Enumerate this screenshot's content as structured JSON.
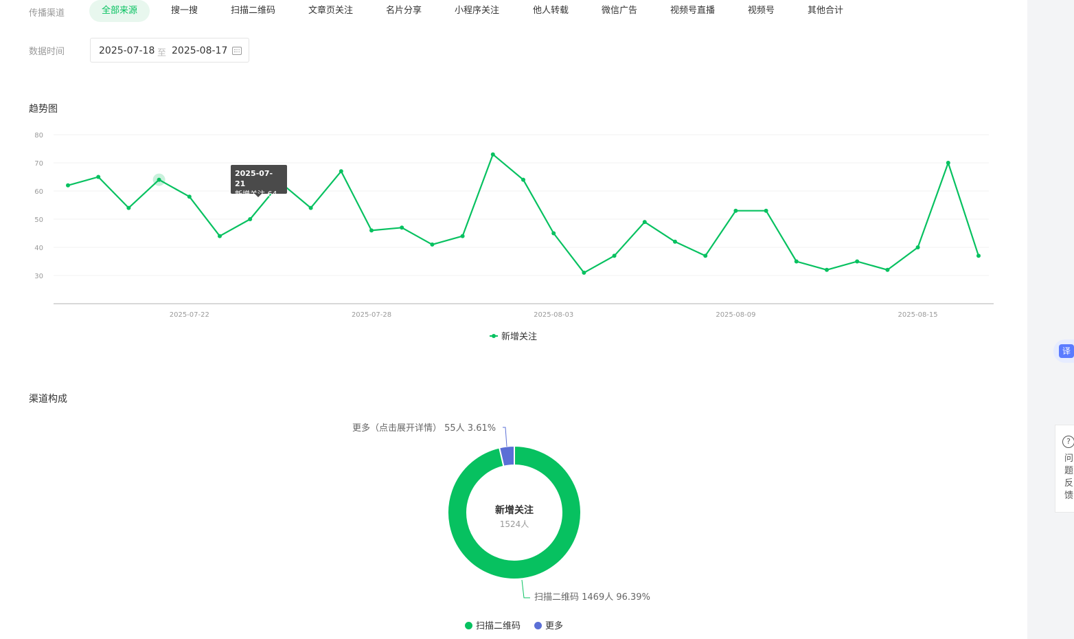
{
  "filters": {
    "source_label": "传播渠道",
    "source_tabs": [
      {
        "label": "全部来源",
        "active": true
      },
      {
        "label": "搜一搜"
      },
      {
        "label": "扫描二维码"
      },
      {
        "label": "文章页关注"
      },
      {
        "label": "名片分享"
      },
      {
        "label": "小程序关注"
      },
      {
        "label": "他人转载"
      },
      {
        "label": "微信广告"
      },
      {
        "label": "视频号直播"
      },
      {
        "label": "视频号"
      },
      {
        "label": "其他合计"
      }
    ],
    "date_label": "数据时间",
    "date_start": "2025-07-18",
    "date_separator": "至",
    "date_end": "2025-08-17"
  },
  "trend": {
    "title": "趋势图",
    "tooltip": {
      "date": "2025-07-21",
      "text": "新增关注 64"
    }
  },
  "channel": {
    "title": "渠道构成",
    "center_title": "新增关注",
    "center_value": "1524人",
    "label_more": "更多（点击展开详情） 55人 3.61%",
    "label_scan": "扫描二维码 1469人 96.39%"
  },
  "side": {
    "translate_icon_text": "译",
    "help_icon_text": "?",
    "feedback_text": "问题反馈"
  },
  "colors": {
    "accent": "#07c160",
    "more": "#5b6fd6"
  },
  "chart_data": [
    {
      "type": "line",
      "title": "",
      "x": [
        "2025-07-18",
        "2025-07-19",
        "2025-07-20",
        "2025-07-21",
        "2025-07-22",
        "2025-07-23",
        "2025-07-24",
        "2025-07-25",
        "2025-07-26",
        "2025-07-27",
        "2025-07-28",
        "2025-07-29",
        "2025-07-30",
        "2025-07-31",
        "2025-08-01",
        "2025-08-02",
        "2025-08-03",
        "2025-08-04",
        "2025-08-05",
        "2025-08-06",
        "2025-08-07",
        "2025-08-08",
        "2025-08-09",
        "2025-08-10",
        "2025-08-11",
        "2025-08-12",
        "2025-08-13",
        "2025-08-14",
        "2025-08-15",
        "2025-08-16",
        "2025-08-17"
      ],
      "series": [
        {
          "name": "新增关注",
          "color": "#07c160",
          "values": [
            62,
            65,
            54,
            64,
            58,
            44,
            50,
            63,
            54,
            67,
            46,
            47,
            41,
            44,
            73,
            64,
            45,
            31,
            37,
            49,
            42,
            37,
            53,
            53,
            35,
            32,
            35,
            32,
            40,
            70,
            37
          ]
        }
      ],
      "x_tick_labels": [
        "2025-07-22",
        "2025-07-28",
        "2025-08-03",
        "2025-08-09",
        "2025-08-15"
      ],
      "y_tick_labels": [
        30,
        40,
        50,
        60,
        70,
        80
      ],
      "ylim": [
        20,
        80
      ],
      "grid": true,
      "legend_position": "bottom-center"
    },
    {
      "type": "pie",
      "title": "",
      "donut": true,
      "slices": [
        {
          "name": "扫描二维码",
          "value": 1469,
          "percent": 96.39,
          "color": "#07c160"
        },
        {
          "name": "更多",
          "value": 55,
          "percent": 3.61,
          "color": "#5b6fd6"
        }
      ],
      "legend_position": "bottom-center"
    }
  ]
}
